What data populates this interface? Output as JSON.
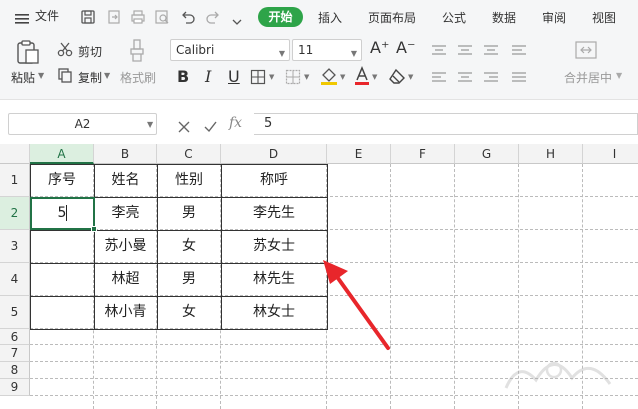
{
  "menu": {
    "file_label": "文件",
    "tabs": [
      "开始",
      "插入",
      "页面布局",
      "公式",
      "数据",
      "审阅",
      "视图"
    ]
  },
  "ribbon": {
    "paste": "粘贴",
    "cut": "剪切",
    "copy": "复制",
    "format_painter": "格式刷",
    "font_name": "Calibri",
    "font_size": "11",
    "merge_center": "合并居中",
    "bold": "B",
    "italic": "I",
    "underline": "U",
    "grow_font": "A⁺",
    "shrink_font": "A⁻"
  },
  "formula_bar": {
    "name_box": "A2",
    "fx_label": "fx",
    "value": "5"
  },
  "sheet": {
    "columns": [
      "A",
      "B",
      "C",
      "D",
      "E",
      "F",
      "G",
      "H",
      "I"
    ],
    "rows": [
      "1",
      "2",
      "3",
      "4",
      "5",
      "6",
      "7",
      "8",
      "9"
    ],
    "selected_cell": "A2",
    "table": {
      "headers": [
        "序号",
        "姓名",
        "性别",
        "称呼"
      ],
      "rows": [
        [
          "5",
          "李亮",
          "男",
          "李先生"
        ],
        [
          "",
          "苏小曼",
          "女",
          "苏女士"
        ],
        [
          "",
          "林超",
          "男",
          "林先生"
        ],
        [
          "",
          "林小青",
          "女",
          "林女士"
        ]
      ]
    }
  },
  "colors": {
    "accent": "#2ea449",
    "selection": "#217346",
    "arrow": "#e8262b"
  }
}
